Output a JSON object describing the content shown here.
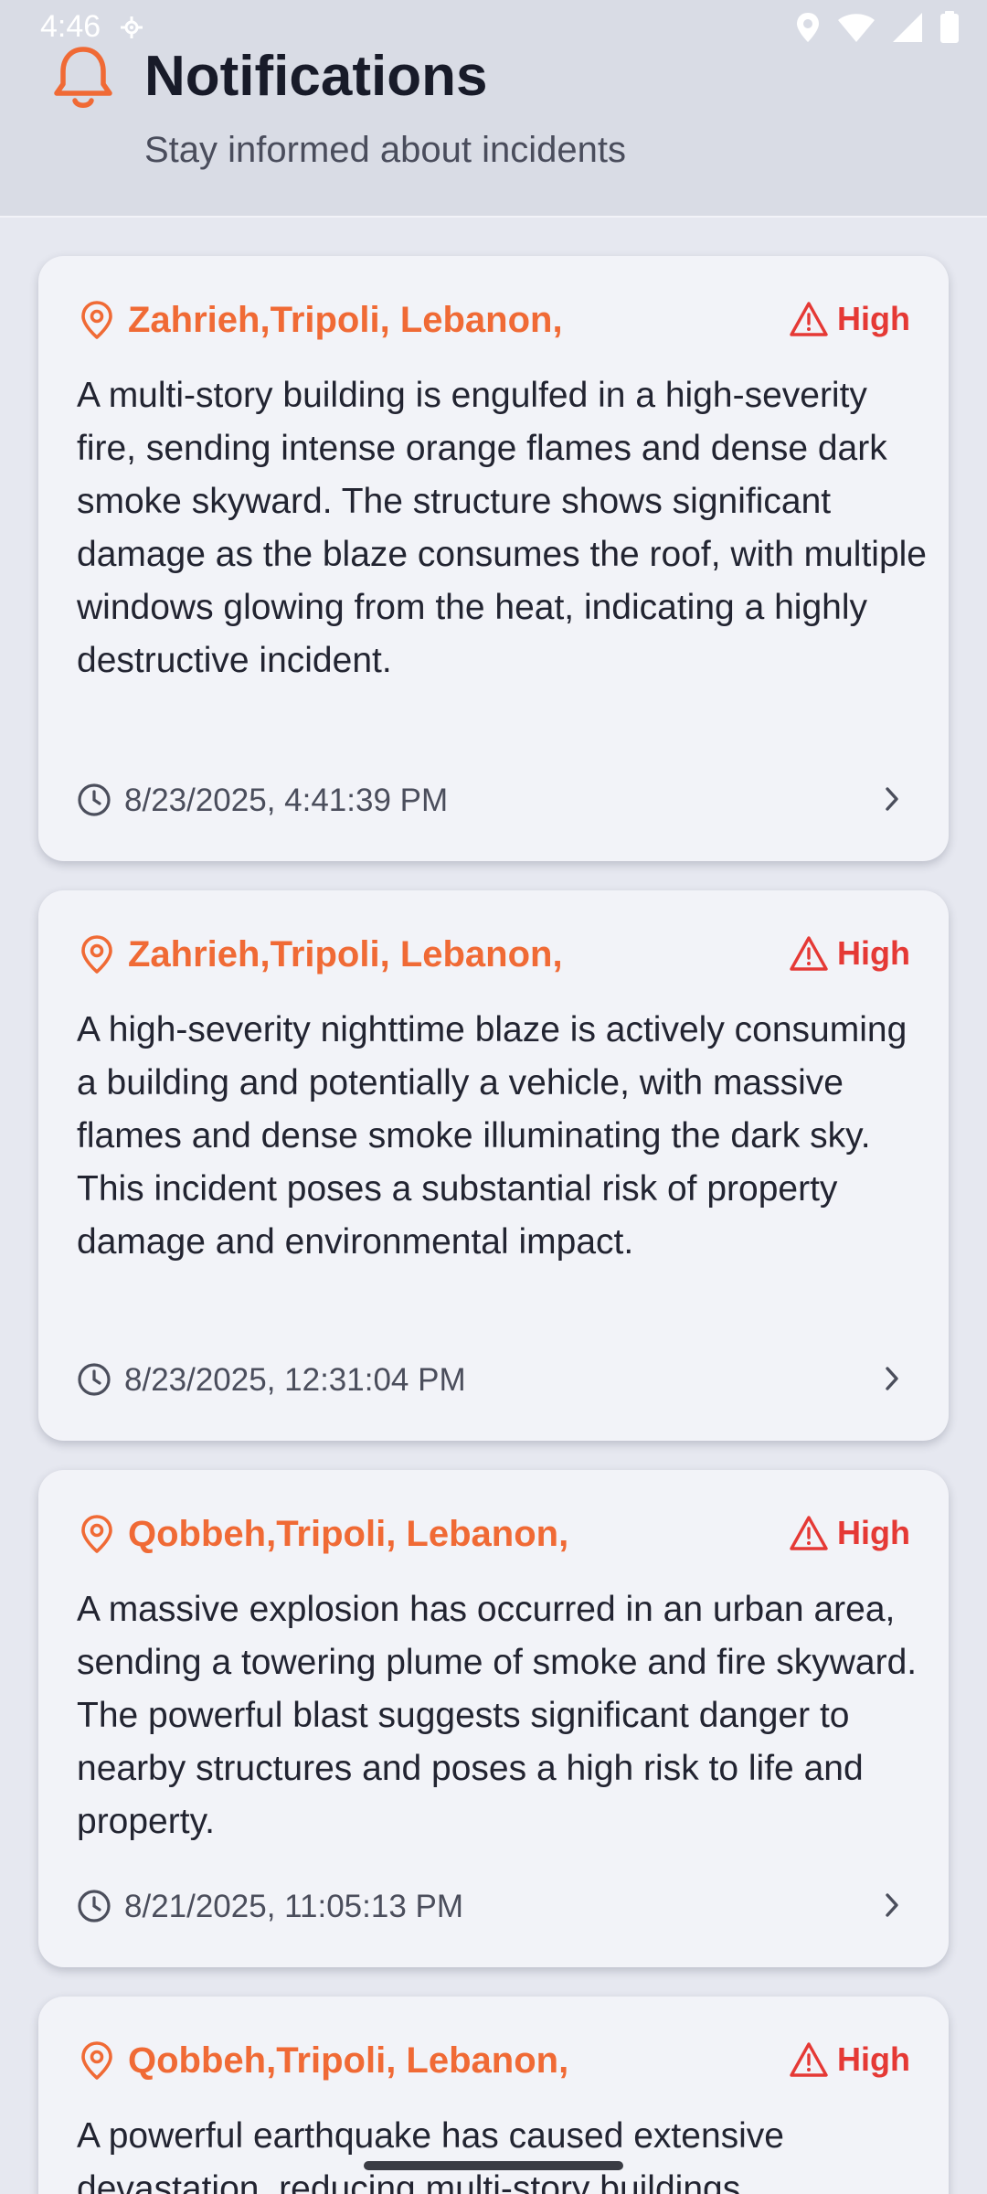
{
  "status": {
    "time": "4:46"
  },
  "header": {
    "title": "Notifications",
    "subtitle": "Stay informed about incidents"
  },
  "colors": {
    "accent": "#f06a35",
    "severity_high": "#e53935",
    "card_bg": "#f2f3f8",
    "page_bg": "#e6e8f0"
  },
  "notifications": [
    {
      "location": "Zahrieh,Tripoli, Lebanon,",
      "severity": "High",
      "description": "A multi-story building is engulfed in a high-severity fire, sending intense orange flames and dense dark smoke skyward. The structure shows significant damage as the blaze consumes the roof, with multiple windows glowing from the heat, indicating a highly destructive incident.",
      "timestamp": "8/23/2025, 4:41:39 PM"
    },
    {
      "location": "Zahrieh,Tripoli, Lebanon,",
      "severity": "High",
      "description": "A high-severity nighttime blaze is actively consuming a building and potentially a vehicle, with massive flames and dense smoke illuminating the dark sky. This incident poses a substantial risk of property damage and environmental impact.",
      "timestamp": "8/23/2025, 12:31:04 PM"
    },
    {
      "location": "Qobbeh,Tripoli, Lebanon,",
      "severity": "High",
      "description": "A massive explosion has occurred in an urban area, sending a towering plume of smoke and fire skyward. The powerful blast suggests significant danger to nearby structures and poses a high risk to life and property.",
      "timestamp": "8/21/2025, 11:05:13 PM"
    },
    {
      "location": "Qobbeh,Tripoli, Lebanon,",
      "severity": "High",
      "description": "A powerful earthquake has caused extensive devastation, reducing multi-story buildings",
      "timestamp": ""
    }
  ]
}
